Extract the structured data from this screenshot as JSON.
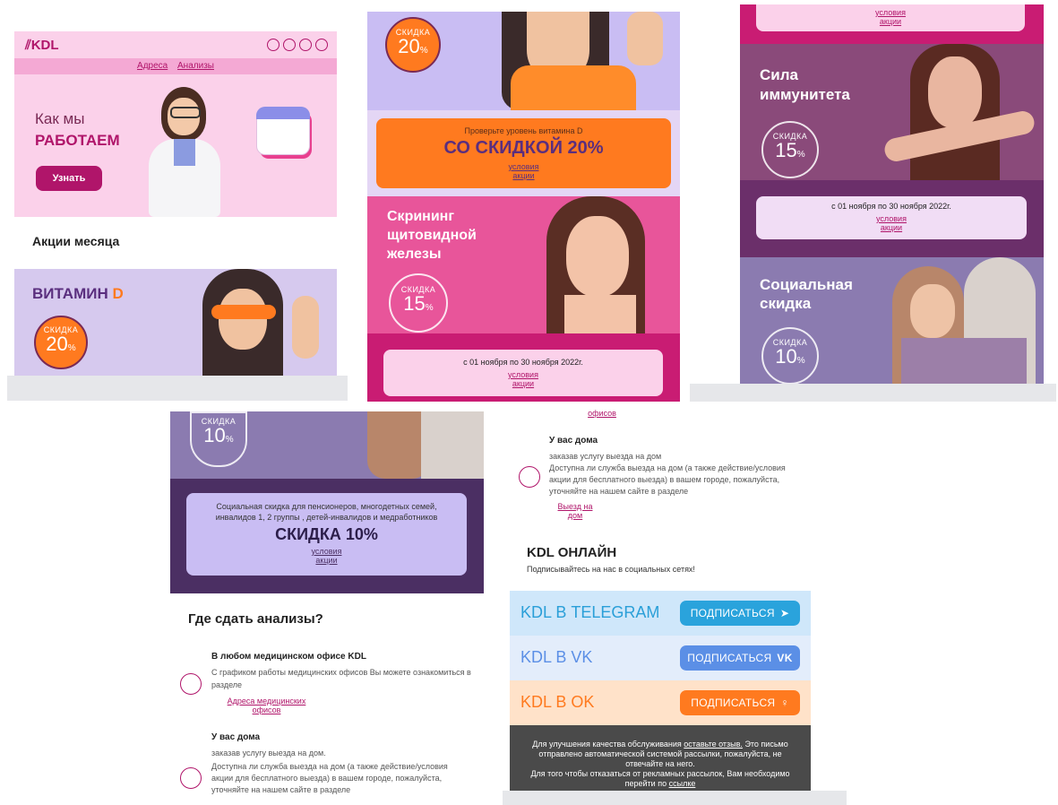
{
  "panel1": {
    "logo": "KDL",
    "social_icons": [
      "telegram-icon",
      "vk-icon",
      "ok-icon",
      "instagram-icon"
    ],
    "nav": [
      "Адреса",
      "Анализы"
    ],
    "hero_line1": "Как мы",
    "hero_line2": "РАБОТАЕМ",
    "hero_button": "Узнать",
    "section_title": "Акции месяца",
    "vitamin_title": "ВИТАМИН",
    "vitamin_d": "D",
    "badge_label": "СКИДКА",
    "badge_value": "20",
    "percent": "%"
  },
  "panel2": {
    "badge_label": "СКИДКА",
    "badge_value": "20",
    "percent": "%",
    "vitd_sub": "Проверьте уровень витамина D",
    "vitd_big": "СО СКИДКОЙ 20%",
    "conditions": [
      "условия",
      "акции"
    ],
    "thyroid_title": [
      "Скрининг",
      "щитовидной",
      "железы"
    ],
    "thyroid_badge_label": "СКИДКА",
    "thyroid_badge_value": "15",
    "dates": "с 01 ноября по 30 ноября 2022г."
  },
  "panel3": {
    "top_conditions": [
      "условия",
      "акции"
    ],
    "immunity_title": [
      "Сила",
      "иммунитета"
    ],
    "immunity_badge_label": "СКИДКА",
    "immunity_badge_value": "15",
    "dates": "с 01 ноября по 30 ноября 2022г.",
    "conditions": [
      "условия",
      "акции"
    ],
    "social_title": [
      "Социальная",
      "скидка"
    ],
    "social_badge_label": "СКИДКА",
    "social_badge_value": "10"
  },
  "panel4": {
    "badge_label": "СКИДКА",
    "badge_value": "10",
    "percent": "%",
    "desc": "Социальная скидка для пенсионеров, многодетных семей, инвалидов 1, 2 группы , детей-инвалидов и медработников",
    "big": "СКИДКА 10%",
    "conditions": [
      "условия",
      "акции"
    ],
    "where_title": "Где сдать анализы?",
    "office_title": "В любом медицинском офисе KDL",
    "office_text": "С графиком работы медицинских офисов Вы можете ознакомиться в разделе",
    "office_link": [
      "Адреса медицинских",
      "офисов"
    ],
    "home_title": "У вас дома",
    "home_text1": "заказав услугу выезда на дом.",
    "home_text2": "Доступна ли служба выезда на дом (а также действие/условия акции для бесплатного выезда) в вашем городе, пожалуйста, уточняйте на нашем сайте в разделе"
  },
  "panel5": {
    "top_link": "офисов",
    "home_title": "У вас дома",
    "home_text1": "заказав услугу выезда на дом",
    "home_text2": "Доступна ли служба выезда на дом (а также действие/условия акции для бесплатного выезда) в вашем городе, пожалуйста, уточняйте на нашем сайте в разделе",
    "home_link": [
      "Выезд на",
      "дом"
    ],
    "online_title": "KDL ОНЛАЙН",
    "online_sub": "Подписывайтесь на нас в социальных сетях!",
    "social": [
      {
        "label": "KDL В TELEGRAM",
        "button": "ПОДПИСАТЬСЯ",
        "icon": "telegram-icon"
      },
      {
        "label": "KDL В VK",
        "button": "ПОДПИСАТЬСЯ",
        "icon": "vk-icon"
      },
      {
        "label": "KDL В OK",
        "button": "ПОДПИСАТЬСЯ",
        "icon": "ok-icon"
      }
    ],
    "footer1a": "Для улучшения качества обслуживания ",
    "footer1_link": "оставьте отзыв.",
    "footer1b": " Это письмо отправлено автоматической системой рассылки, пожалуйста, не отвечайте на него.",
    "footer2a": "Для того чтобы отказаться от рекламных рассылок, Вам необходимо перейти по ",
    "footer2_link": "ссылке"
  },
  "colors": {
    "brand": "#b0156a",
    "pink_bg": "#fbd1ea",
    "orange": "#ff7a1f",
    "lavender": "#c9bdf3",
    "purple_dark": "#4b2f63",
    "telegram": "#2aa3dc",
    "vk": "#5b8fe6",
    "ok": "#ff7a1f"
  }
}
